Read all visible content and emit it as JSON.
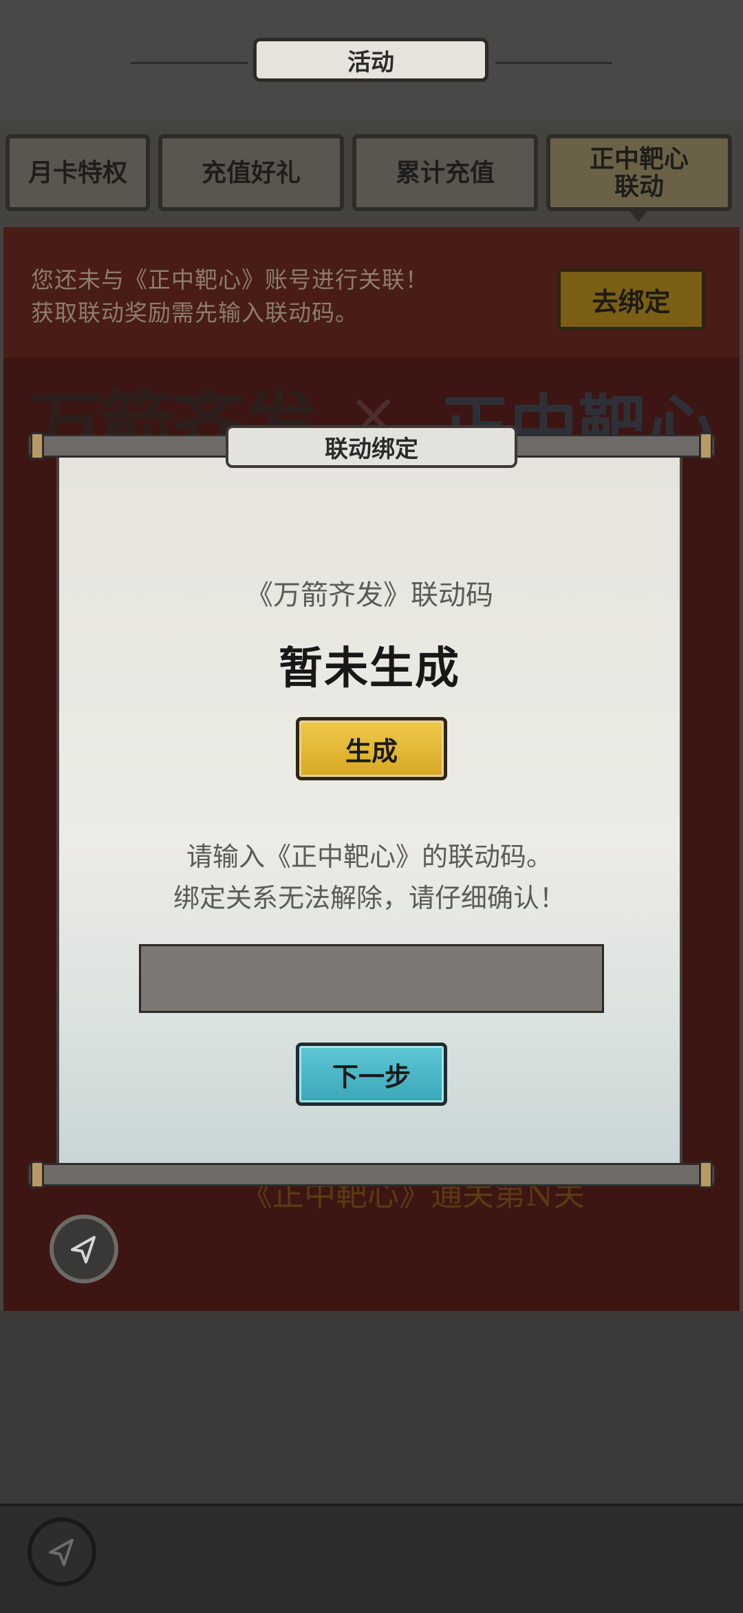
{
  "header": {
    "title": "活动"
  },
  "tabs": [
    {
      "label": "月卡特权",
      "active": false
    },
    {
      "label": "充值好礼",
      "active": false
    },
    {
      "label": "累计充值",
      "active": false
    },
    {
      "label": "正中靶心\n联动",
      "active": true
    }
  ],
  "background": {
    "notice": "您还未与《正中靶心》账号进行关联！\n获取联动奖励需先输入联动码。",
    "bind_button": "去绑定",
    "logo_left": "万箭齐发",
    "logo_separator": "×",
    "logo_right": "正中靶心",
    "obscured_text": "《正中靶心》通关第N关"
  },
  "modal": {
    "title": "联动绑定",
    "code_label": "《万箭齐发》联动码",
    "code_value": "暂未生成",
    "generate_button": "生成",
    "instruction": "请输入《正中靶心》的联动码。\n绑定关系无法解除，请仔细确认！",
    "input_value": "",
    "next_button": "下一步"
  },
  "icons": {
    "back": "back-arrow-icon"
  },
  "colors": {
    "gold_button": "#e0b737",
    "teal_button": "#48b4c4",
    "panel_red": "#3d1512"
  }
}
